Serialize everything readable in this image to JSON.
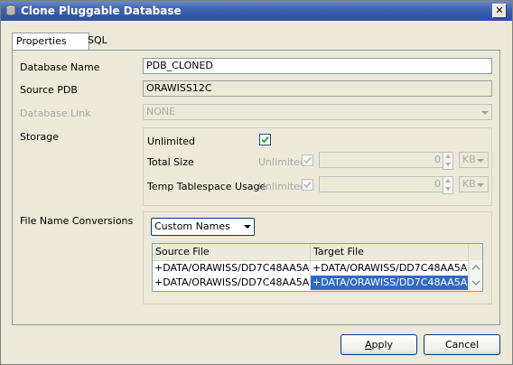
{
  "window": {
    "title": "Clone Pluggable Database",
    "close_glyph": "✕"
  },
  "tabs": [
    {
      "label": "Properties",
      "active": true
    },
    {
      "label": "SQL",
      "active": false
    }
  ],
  "form": {
    "database_name": {
      "label": "Database Name",
      "value": "PDB_CLONED"
    },
    "source_pdb": {
      "label": "Source PDB",
      "value": "ORAWISS12C"
    },
    "database_link": {
      "label": "Database Link",
      "value": "NONE"
    },
    "storage": {
      "label": "Storage",
      "unlimited_label": "Unlimited",
      "unlimited_checked": true,
      "total_size": {
        "label": "Total Size",
        "unlimited_label": "Unlimited",
        "value": "0",
        "unit": "KB"
      },
      "temp_tablespace": {
        "label": "Temp Tablespace Usage",
        "unlimited_label": "Unlimited",
        "value": "0",
        "unit": "KB"
      }
    },
    "file_name_conversions": {
      "label": "File Name Conversions",
      "mode": "Custom Names",
      "columns": [
        "Source File",
        "Target File"
      ],
      "rows": [
        [
          "+DATA/ORAWISS/DD7C48AA5A...",
          "+DATA/ORAWISS/DD7C48AA5A..."
        ],
        [
          "+DATA/ORAWISS/DD7C48AA5A...",
          "+DATA/ORAWISS/DD7C48AA5A..."
        ]
      ]
    }
  },
  "buttons": {
    "apply_prefix": "A",
    "apply_rest": "pply",
    "cancel": "Cancel"
  },
  "colors": {
    "title_bar": "#2a4fa3",
    "selection": "#316ac5",
    "checkmark": "#21a121"
  },
  "icons": {
    "app": "database-icon",
    "close": "close-icon",
    "dropdown": "chevron-down-icon",
    "check": "check-icon"
  }
}
